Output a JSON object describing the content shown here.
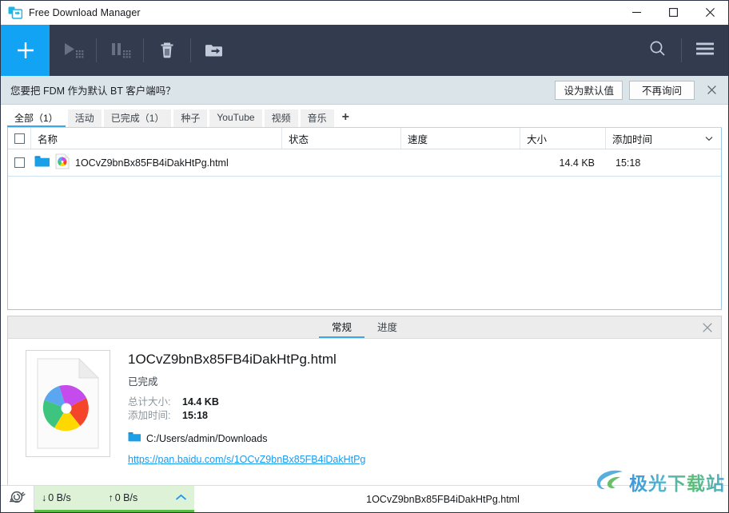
{
  "window": {
    "title": "Free Download Manager",
    "app_icon": "download-manager-icon",
    "minimize": "minimize-icon",
    "maximize": "maximize-icon",
    "close": "close-icon"
  },
  "toolbar": {
    "add_label": "+",
    "buttons": [
      {
        "name": "start-download-button",
        "icon": "play-icon",
        "disabled": true
      },
      {
        "name": "pause-download-button",
        "icon": "pause-icon",
        "disabled": true
      },
      {
        "name": "delete-download-button",
        "icon": "trash-icon",
        "disabled": false
      },
      {
        "name": "move-download-button",
        "icon": "folder-arrow-icon",
        "disabled": false
      }
    ],
    "search_icon": "search-icon",
    "menu_icon": "hamburger-menu-icon"
  },
  "notification": {
    "message": "您要把 FDM 作为默认 BT 客户端吗？",
    "primary_button": "设为默认值",
    "secondary_button": "不再询问",
    "close_icon": "close-icon"
  },
  "filter_tabs": [
    {
      "label": "全部（1）",
      "active": true
    },
    {
      "label": "活动",
      "active": false
    },
    {
      "label": "已完成（1）",
      "active": false
    },
    {
      "label": "种子",
      "active": false
    },
    {
      "label": "YouTube",
      "active": false
    },
    {
      "label": "视频",
      "active": false
    },
    {
      "label": "音乐",
      "active": false
    }
  ],
  "filter_add_label": "+",
  "list": {
    "columns": [
      "名称",
      "状态",
      "速度",
      "大小",
      "添加时间"
    ],
    "sort_column": "添加时间",
    "sort_icon": "chevron-down-icon",
    "rows": [
      {
        "checked": false,
        "folder_icon": "folder-icon",
        "file_icon": "html-file-icon",
        "name": "1OCvZ9bnBx85FB4iDakHtPg.html",
        "status": "",
        "speed": "",
        "size": "14.4 KB",
        "added": "15:18"
      }
    ]
  },
  "detail": {
    "tabs": [
      {
        "label": "常规",
        "active": true
      },
      {
        "label": "进度",
        "active": false
      }
    ],
    "close_icon": "close-icon",
    "thumbnail_icon": "html-file-thumbnail",
    "title": "1OCvZ9bnBx85FB4iDakHtPg.html",
    "status": "已完成",
    "fields": [
      {
        "key": "总计大小:",
        "value": "14.4 KB"
      },
      {
        "key": "添加时间:",
        "value": "15:18"
      }
    ],
    "folder_icon": "folder-icon",
    "path": "C:/Users/admin/Downloads",
    "url": "https://pan.baidu.com/s/1OCvZ9bnBx85FB4iDakHtPg"
  },
  "statusbar": {
    "speed_limit_icon": "snail-icon",
    "download_arrow": "↓",
    "download_speed": "0 B/s",
    "upload_arrow": "↑",
    "upload_speed": "0 B/s",
    "expand_icon": "chevron-up-icon",
    "current_file": "1OCvZ9bnBx85FB4iDakHtPg.html"
  },
  "watermark": {
    "text": "极光下载站",
    "logo": "swirl-logo-icon"
  },
  "colors": {
    "accent_blue": "#12a3f5",
    "toolbar_bg": "#333b4f",
    "notify_bg": "#dbe4e8",
    "speed_green": "#ddf2d7",
    "link_blue": "#1a9bf0"
  }
}
